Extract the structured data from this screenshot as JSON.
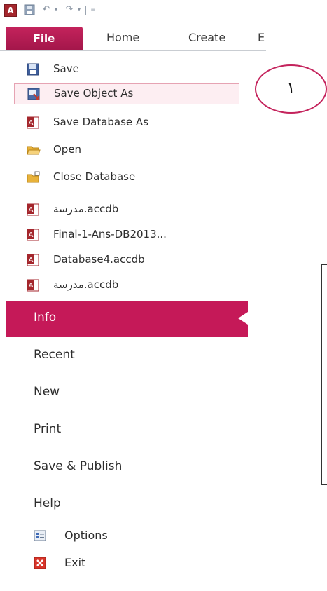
{
  "quick_access": {
    "app_icon": "A",
    "save_icon": "save-icon",
    "undo_icon": "undo-icon",
    "redo_icon": "redo-icon",
    "customize_icon": "customize-qat-icon"
  },
  "ribbon": {
    "tabs": [
      {
        "label": "File",
        "active": true
      },
      {
        "label": "Home"
      },
      {
        "label": "Create"
      },
      {
        "label": "E"
      }
    ]
  },
  "backstage": {
    "commands": [
      {
        "label": "Save",
        "icon": "save-icon"
      },
      {
        "label": "Save Object As",
        "icon": "save-object-as-icon",
        "highlighted": true
      },
      {
        "label": "Save Database As",
        "icon": "access-db-icon"
      },
      {
        "label": "Open",
        "icon": "open-folder-icon"
      },
      {
        "label": "Close Database",
        "icon": "close-folder-icon"
      }
    ],
    "recent_files": [
      {
        "label": "مدرسة.accdb"
      },
      {
        "label": "Final-1-Ans-DB2013..."
      },
      {
        "label": "Database4.accdb"
      },
      {
        "label": "مدرسة.accdb"
      }
    ],
    "sections": [
      {
        "label": "Info",
        "active": true
      },
      {
        "label": "Recent"
      },
      {
        "label": "New"
      },
      {
        "label": "Print"
      },
      {
        "label": "Save & Publish"
      },
      {
        "label": "Help"
      }
    ],
    "footer": [
      {
        "label": "Options",
        "icon": "options-icon"
      },
      {
        "label": "Exit",
        "icon": "exit-icon"
      }
    ]
  },
  "annotation": {
    "number": "١"
  },
  "colors": {
    "accent": "#c51958",
    "hover_border": "#e6a3b3",
    "hover_bg": "#fdeef2"
  }
}
